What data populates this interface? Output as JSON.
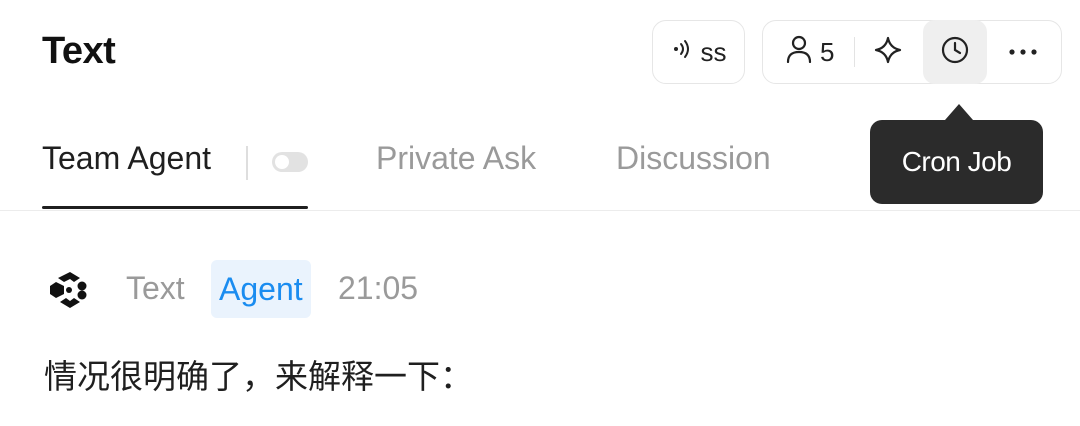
{
  "header": {
    "title": "Text",
    "live_label": "ss",
    "member_count": "5",
    "tooltip": "Cron Job"
  },
  "tabs": [
    {
      "label": "Team Agent",
      "active": true
    },
    {
      "label": "Private Ask",
      "active": false
    },
    {
      "label": "Discussion",
      "active": false
    }
  ],
  "toggle": {
    "on": false
  },
  "message": {
    "sender": "Text",
    "badge": "Agent",
    "time": "21:05",
    "body": "情况很明确了，来解释一下："
  },
  "colors": {
    "badge_bg": "#eaf3fd",
    "badge_text": "#1a8cf0",
    "tooltip_bg": "#2b2b2b"
  },
  "icons": [
    "broadcast-icon",
    "user-icon",
    "sparkle-icon",
    "clock-icon",
    "more-icon",
    "agent-logo-icon"
  ]
}
